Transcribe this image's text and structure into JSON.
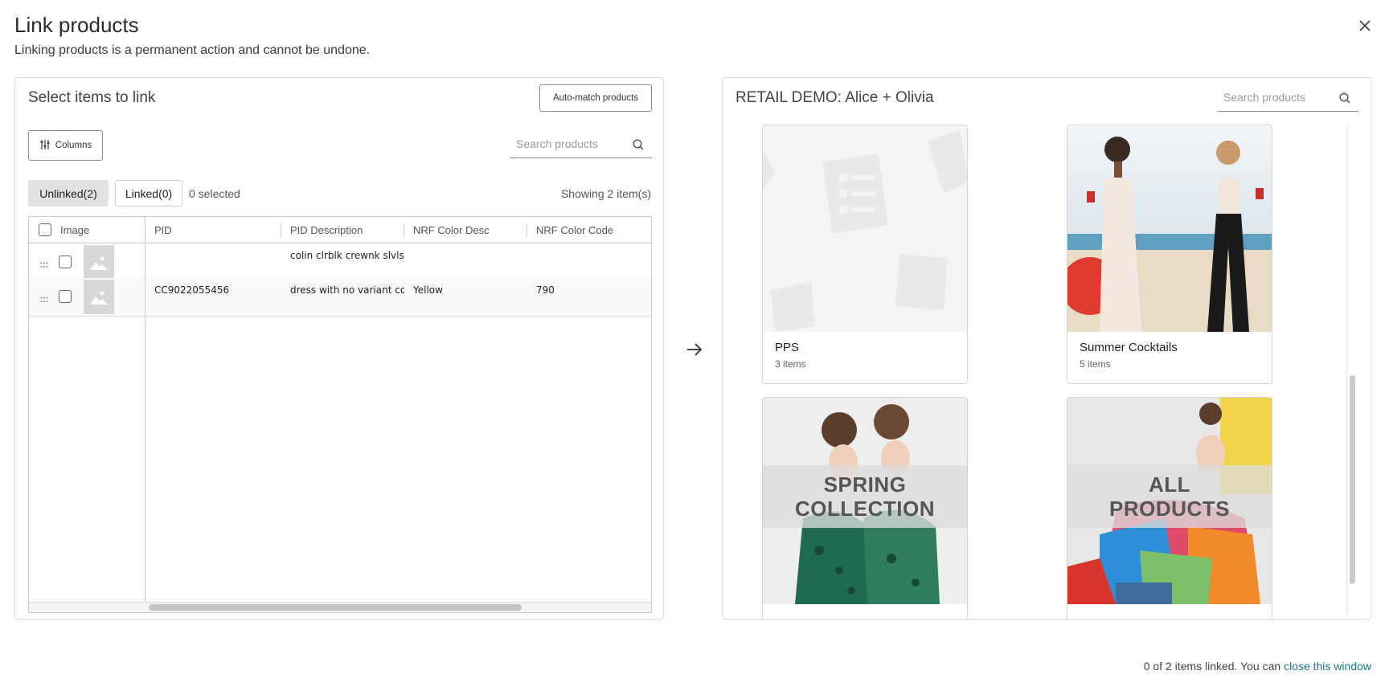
{
  "header": {
    "title": "Link products",
    "subtitle": "Linking products is a permanent action and cannot be undone."
  },
  "left": {
    "title": "Select items to link",
    "automatch_label": "Auto-match products",
    "columns_label": "Columns",
    "search_placeholder": "Search products",
    "tabs": [
      {
        "label": "Unlinked(2)",
        "active": true
      },
      {
        "label": "Linked(0)",
        "active": false
      }
    ],
    "selected_text": "0 selected",
    "showing_text": "Showing 2 item(s)",
    "grid": {
      "headers": [
        "Image",
        "PID",
        "PID Description",
        "NRF Color Desc",
        "NRF Color Code"
      ],
      "rows": [
        {
          "pid": "",
          "description": "colin clrblk crewnk slvlss d",
          "color_desc": "",
          "color_code": ""
        },
        {
          "pid": "CC9022055456",
          "description": "dress with no variant color",
          "color_desc": "Yellow",
          "color_code": "790"
        }
      ]
    }
  },
  "right": {
    "title": "RETAIL DEMO: Alice + Olivia",
    "search_placeholder": "Search products",
    "collections": [
      {
        "name": "PPS",
        "count": "3 items"
      },
      {
        "name": "Summer Cocktails",
        "count": "5 items"
      },
      {
        "name": "",
        "count": "",
        "banner": "SPRING COLLECTION"
      },
      {
        "name": "",
        "count": "",
        "banner": "ALL PRODUCTS"
      }
    ]
  },
  "footer": {
    "text": "0 of 2 items linked. You can",
    "link": "close this window"
  },
  "colors": {
    "accent_link": "#1a7a8a",
    "tab_active_bg": "#e2e2e2",
    "border": "#dcdcdc"
  },
  "icons": [
    "close-icon",
    "columns-sliders-icon",
    "search-icon",
    "drag-handle-icon",
    "image-placeholder-icon",
    "arrow-right-icon"
  ]
}
